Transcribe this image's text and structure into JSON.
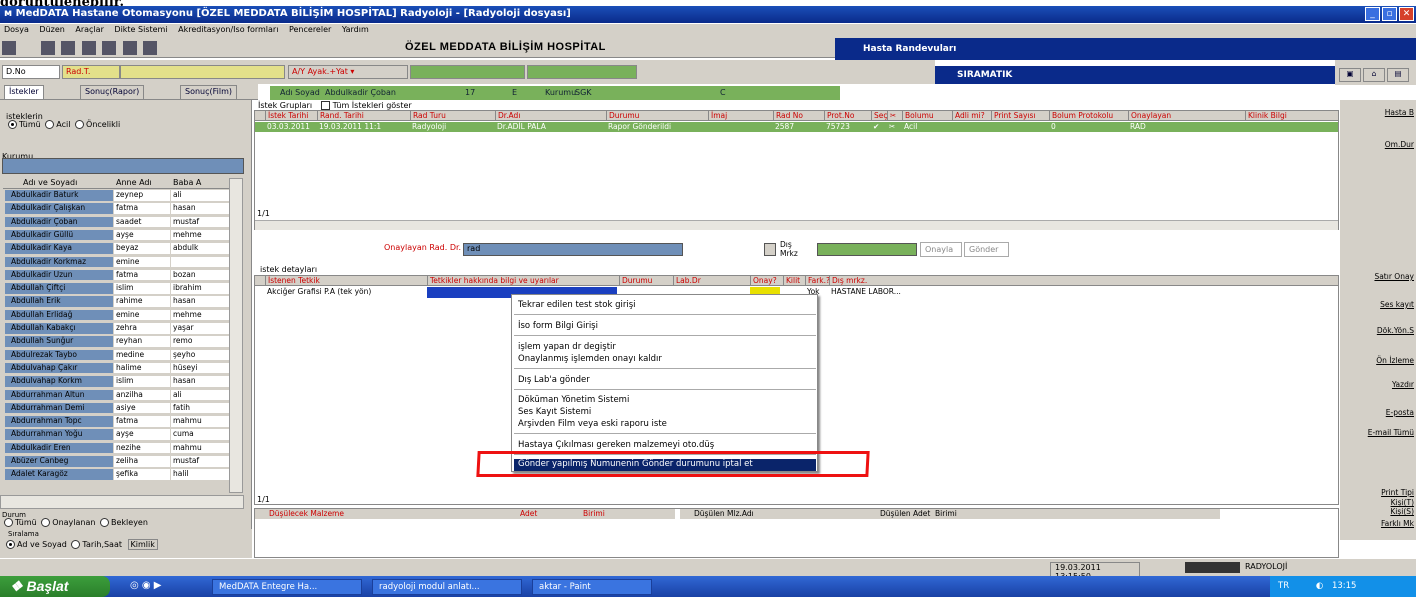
{
  "caption": "görüntülenebilir.",
  "window": {
    "title": "MedDATA Hastane Otomasyonu [ÖZEL MEDDATA BİLİŞİM HOSPİTAL] Radyoloji - [Radyoloji dosyası]",
    "minimize": "_",
    "restore": "▫",
    "close": "✕"
  },
  "menu": [
    "Dosya",
    "Düzen",
    "Araçlar",
    "Dikte Sistemi",
    "Akreditasyon/Iso formları",
    "Pencereler",
    "Yardım"
  ],
  "hospital_name": "ÖZEL MEDDATA BİLİŞİM HOSPİTAL",
  "hasta_randevulari": "Hasta Randevuları",
  "siramatik": "SIRAMATIK",
  "filters": {
    "dno": "D.No",
    "radt": "Rad.T.",
    "ayak": "A/Y Ayak.+Yat ▾"
  },
  "tabs": [
    "İstekler",
    "Sonuç(Rapor)",
    "Sonuç(Film)"
  ],
  "patient_info": {
    "label": "Adı Soyad",
    "name": "Abdulkadir Çoban",
    "num": "17",
    "gender": "E",
    "kurumu_label": "Kurumu",
    "kurumu": "SGK",
    "c": "C"
  },
  "left": {
    "istekler_label": "isteklerin",
    "radios": [
      "Tümü",
      "Acil",
      "Öncelikli"
    ],
    "kurumu": "Kurumu",
    "headers": [
      "Adı ve Soyadı",
      "Anne Adı",
      "Baba A"
    ],
    "patients": [
      [
        "Abdulkadir Baturk",
        "zeynep",
        "ali"
      ],
      [
        "Abdulkadir Çalışkan",
        "fatma",
        "hasan"
      ],
      [
        "Abdulkadir Çoban",
        "saadet",
        "mustaf"
      ],
      [
        "Abdulkadir Güllü",
        "ayşe",
        "mehme"
      ],
      [
        "Abdulkadir Kaya",
        "beyaz",
        "abdulk"
      ],
      [
        "Abdulkadir Korkmaz",
        "emine",
        ""
      ],
      [
        "Abdulkadir Uzun",
        "fatma",
        "bozan"
      ],
      [
        "Abdullah Çiftçi",
        "islim",
        "ibrahim"
      ],
      [
        "Abdullah Erik",
        "rahime",
        "hasan"
      ],
      [
        "Abdullah Erlidağ",
        "emine",
        "mehme"
      ],
      [
        "Abdullah Kabakçı",
        "zehra",
        "yaşar"
      ],
      [
        "Abdullah Sunğur",
        "reyhan",
        "remo"
      ],
      [
        "Abdulrezak Taybo",
        "medine",
        "şeyho"
      ],
      [
        "Abdulvahap Çakır",
        "halime",
        "hüseyi"
      ],
      [
        "Abdulvahap Korkm",
        "islim",
        "hasan"
      ],
      [
        "Abdurrahman Altun",
        "anzilha",
        "ali"
      ],
      [
        "Abdurrahman Demi",
        "asiye",
        "fatih"
      ],
      [
        "Abdurrahman Topc",
        "fatma",
        "mahmu"
      ],
      [
        "Abdurrahman Yoğu",
        "ayşe",
        "cuma"
      ],
      [
        "Abdulkadir Eren",
        "nezihe",
        "mahmu"
      ],
      [
        "Abüzer Canbeg",
        "zeliha",
        "mustaf"
      ],
      [
        "Adalet Karagöz",
        "şefika",
        "halil"
      ]
    ],
    "durum_label": "Durum",
    "durum_radios": [
      "Tümü",
      "Onaylanan",
      "Bekleyen"
    ],
    "siralama_label": "Sıralama",
    "siralama_radios": [
      "Ad ve Soyad",
      "Tarih,Saat"
    ],
    "kimlik": "Kimlik"
  },
  "requests": {
    "groups_label": "İstek Grupları",
    "show_all": "Tüm İstekleri göster",
    "headers": [
      "İstek Tarihi",
      "Rand. Tarihi",
      "Rad Turu",
      "Dr.Adı",
      "Durumu",
      "İmaj",
      "Rad No",
      "Prot.No",
      "Seç",
      "✂",
      "Bolumu",
      "Adli mi?",
      "Print Sayısı",
      "Bolum Protokolu",
      "Onaylayan",
      "Klinik Bilgi"
    ],
    "row": [
      "03.03.2011",
      "19.03.2011 11:1",
      "Radyoloji",
      "Dr.ADİL PALA",
      "Rapor Gönderildi",
      "",
      "2587",
      "75723",
      "✔",
      "✂",
      "Acil",
      "",
      "",
      "0",
      "RAD",
      ""
    ],
    "counter": "1/1",
    "onaylayan_label": "Onaylayan Rad. Dr.",
    "onaylayan_value": "rad",
    "dis_merkez": "Dış Mrkz",
    "onayla": "Onayla",
    "gonder": "Gönder"
  },
  "details": {
    "label": "istek detayları",
    "headers": [
      "İstenen Tetkik",
      "Tetkikler hakkında bilgi ve uyarılar",
      "Durumu",
      "Lab.Dr",
      "Onay?",
      "Kilit",
      "Fark.?",
      "Dış mrkz."
    ],
    "row": [
      "Akciğer Grafisi P.A (tek yön)",
      "",
      "",
      "",
      "",
      "",
      "Yok",
      "HASTANE LABOR..."
    ],
    "counter": "1/1"
  },
  "context_menu": [
    "Tekrar edilen test stok girişi",
    "İso form Bilgi Girişi",
    "işlem yapan dr degiştir",
    "Onaylanmış işlemden onayı kaldır",
    "Dış Lab'a gönder",
    "Döküman Yönetim Sistemi",
    "Ses Kayıt Sistemi",
    "Arşivden Film veya eski raporu iste",
    "Hastaya Çıkılması gereken malzemeyi oto.düş",
    "Gönder yapılmış Numunenin Gönder durumunu iptal et"
  ],
  "malzeme": {
    "headers_left": [
      "Düşülecek Malzeme",
      "Adet",
      "Birimi"
    ],
    "headers_right": [
      "Düşülen Mlz.Adı",
      "Düşülen Adet",
      "Birimi"
    ]
  },
  "right_panel": [
    "Hasta B",
    "Om.Dur",
    "Satır Onay",
    "Ses kayıt",
    "Dök.Yön.S",
    "Ön İzleme",
    "Yazdır",
    "E-posta",
    "E-mail Tümü",
    "Print Tipi",
    "Kişi(T)",
    "Kişi(S)",
    "Farklı Mk"
  ],
  "status": {
    "datetime": "19.03.2011 13:15:50",
    "module": "RADYOLOJİ"
  },
  "taskbar": {
    "start": "Başlat",
    "tasks": [
      "MedDATA Entegre Ha...",
      "radyoloji modul anlatı...",
      "aktar - Paint"
    ],
    "lang": "TR",
    "clock": "13:15"
  }
}
